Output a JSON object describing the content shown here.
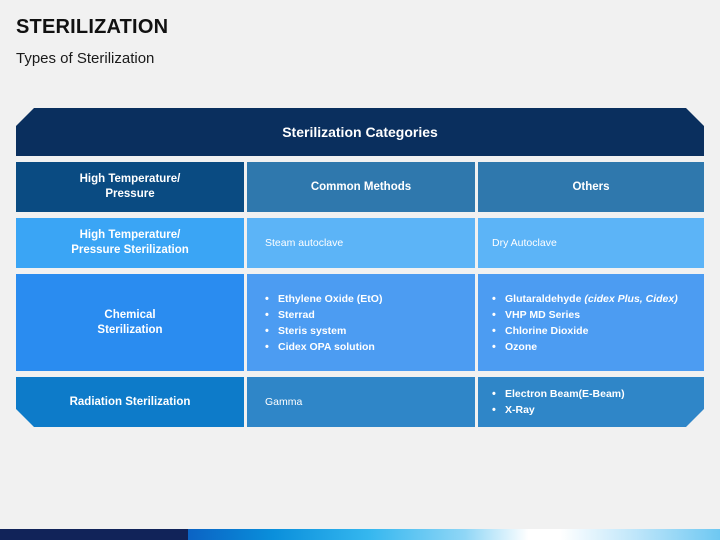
{
  "slide": {
    "title": "STERILIZATION",
    "subtitle": "Types of Sterilization"
  },
  "banner": {
    "label": "Sterilization Categories"
  },
  "colors": {
    "background": "#f1f1f1",
    "banner_navy": "#0a2f5e",
    "header_dark_blue": "#0a4b82",
    "header_steel_blue": "#2f78ad",
    "row1_accent": "#3aa5f5",
    "row1_fill": "#5cb4f7",
    "row2_accent": "#2a8cf0",
    "row2_fill": "#4c9cf2",
    "row3_accent": "#0d7bc9",
    "row3_fill": "#2f86c8",
    "bottom_bar_navy": "#112359",
    "text_white": "#ffffff",
    "title_text": "#111111"
  },
  "table": {
    "headers": {
      "col1_line1": "High Temperature/",
      "col1_line2": "Pressure",
      "col2": "Common Methods",
      "col3": "Others"
    },
    "rows": [
      {
        "id": "high-temperature-pressure-sterilization",
        "label_line1": "High Temperature/",
        "label_line2": "Pressure Sterilization",
        "common_methods_text": "Steam autoclave",
        "others_text": "Dry Autoclave",
        "common_methods_bullets": [],
        "others_bullets": []
      },
      {
        "id": "chemical-sterilization",
        "label_line1": "Chemical",
        "label_line2": "Sterilization",
        "common_methods_text": "",
        "others_text": "",
        "common_methods_bullets": [
          {
            "text": "Ethylene Oxide (EtO)",
            "note": ""
          },
          {
            "text": "Sterrad",
            "note": ""
          },
          {
            "text": "Steris system",
            "note": ""
          },
          {
            "text": "Cidex OPA solution",
            "note": ""
          }
        ],
        "others_bullets": [
          {
            "text": "Glutaraldehyde ",
            "note": "(cidex Plus, Cidex)"
          },
          {
            "text": "VHP MD Series",
            "note": ""
          },
          {
            "text": "Chlorine Dioxide",
            "note": ""
          },
          {
            "text": "Ozone",
            "note": ""
          }
        ]
      },
      {
        "id": "radiation-sterilization",
        "label_line1": "Radiation Sterilization",
        "label_line2": "",
        "common_methods_text": "Gamma",
        "others_text": "",
        "common_methods_bullets": [],
        "others_bullets": [
          {
            "text": "Electron Beam(E-Beam)",
            "note": ""
          },
          {
            "text": "X-Ray",
            "note": ""
          }
        ]
      }
    ]
  }
}
